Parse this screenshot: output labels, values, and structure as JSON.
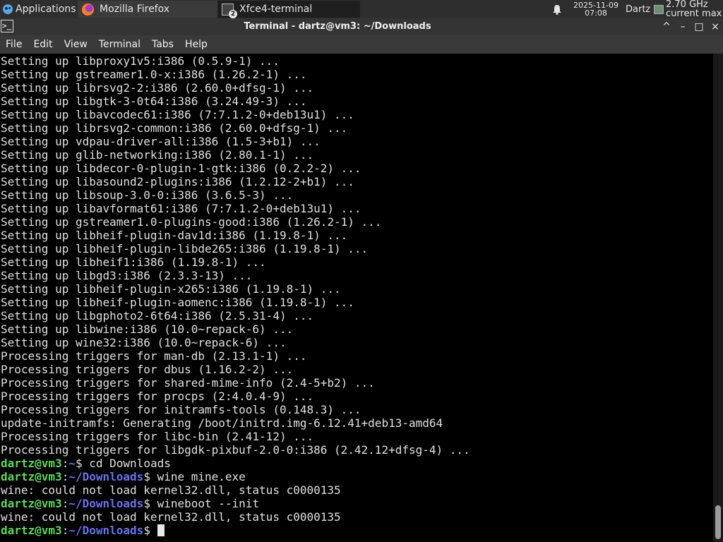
{
  "panel": {
    "applications_label": "Applications",
    "tasks": [
      {
        "label": "Mozilla Firefox",
        "icon": "firefox-icon"
      },
      {
        "label": "Xfce4-terminal",
        "icon": "terminal-icon",
        "badge": "2"
      }
    ],
    "clock": {
      "date": "2025-11-09",
      "time": "07:08"
    },
    "user": "Dartz",
    "cpu": {
      "freq": "2.70 GHz",
      "mode": "current max"
    }
  },
  "window": {
    "title": "Terminal - dartz@vm3: ~/Downloads",
    "buttons": [
      "^",
      "–",
      "□",
      "×"
    ]
  },
  "menu": [
    "File",
    "Edit",
    "View",
    "Terminal",
    "Tabs",
    "Help"
  ],
  "terminal": {
    "output": [
      "Setting up libproxy1v5:i386 (0.5.9-1) ...",
      "Setting up gstreamer1.0-x:i386 (1.26.2-1) ...",
      "Setting up librsvg2-2:i386 (2.60.0+dfsg-1) ...",
      "Setting up libgtk-3-0t64:i386 (3.24.49-3) ...",
      "Setting up libavcodec61:i386 (7:7.1.2-0+deb13u1) ...",
      "Setting up librsvg2-common:i386 (2.60.0+dfsg-1) ...",
      "Setting up vdpau-driver-all:i386 (1.5-3+b1) ...",
      "Setting up glib-networking:i386 (2.80.1-1) ...",
      "Setting up libdecor-0-plugin-1-gtk:i386 (0.2.2-2) ...",
      "Setting up libasound2-plugins:i386 (1.2.12-2+b1) ...",
      "Setting up libsoup-3.0-0:i386 (3.6.5-3) ...",
      "Setting up libavformat61:i386 (7:7.1.2-0+deb13u1) ...",
      "Setting up gstreamer1.0-plugins-good:i386 (1.26.2-1) ...",
      "Setting up libheif-plugin-dav1d:i386 (1.19.8-1) ...",
      "Setting up libheif-plugin-libde265:i386 (1.19.8-1) ...",
      "Setting up libheif1:i386 (1.19.8-1) ...",
      "Setting up libgd3:i386 (2.3.3-13) ...",
      "Setting up libheif-plugin-x265:i386 (1.19.8-1) ...",
      "Setting up libheif-plugin-aomenc:i386 (1.19.8-1) ...",
      "Setting up libgphoto2-6t64:i386 (2.5.31-4) ...",
      "Setting up libwine:i386 (10.0~repack-6) ...",
      "Setting up wine32:i386 (10.0~repack-6) ...",
      "Processing triggers for man-db (2.13.1-1) ...",
      "Processing triggers for dbus (1.16.2-2) ...",
      "Processing triggers for shared-mime-info (2.4-5+b2) ...",
      "Processing triggers for procps (2:4.0.4-9) ...",
      "Processing triggers for initramfs-tools (0.148.3) ...",
      "update-initramfs: Generating /boot/initrd.img-6.12.41+deb13-amd64",
      "Processing triggers for libc-bin (2.41-12) ...",
      "Processing triggers for libgdk-pixbuf-2.0-0:i386 (2.42.12+dfsg-4) ..."
    ],
    "session": [
      {
        "user": "dartz@vm3",
        "sep": ":",
        "path": "~",
        "dollar": "$ ",
        "cmd": "cd Downloads"
      },
      {
        "user": "dartz@vm3",
        "sep": ":",
        "path": "~/Downloads",
        "dollar": "$ ",
        "cmd": "wine mine.exe"
      },
      {
        "out": "wine: could not load kernel32.dll, status c0000135"
      },
      {
        "user": "dartz@vm3",
        "sep": ":",
        "path": "~/Downloads",
        "dollar": "$ ",
        "cmd": "wineboot --init"
      },
      {
        "out": "wine: could not load kernel32.dll, status c0000135"
      },
      {
        "user": "dartz@vm3",
        "sep": ":",
        "path": "~/Downloads",
        "dollar": "$ ",
        "cmd": "",
        "cursor": true
      }
    ]
  }
}
